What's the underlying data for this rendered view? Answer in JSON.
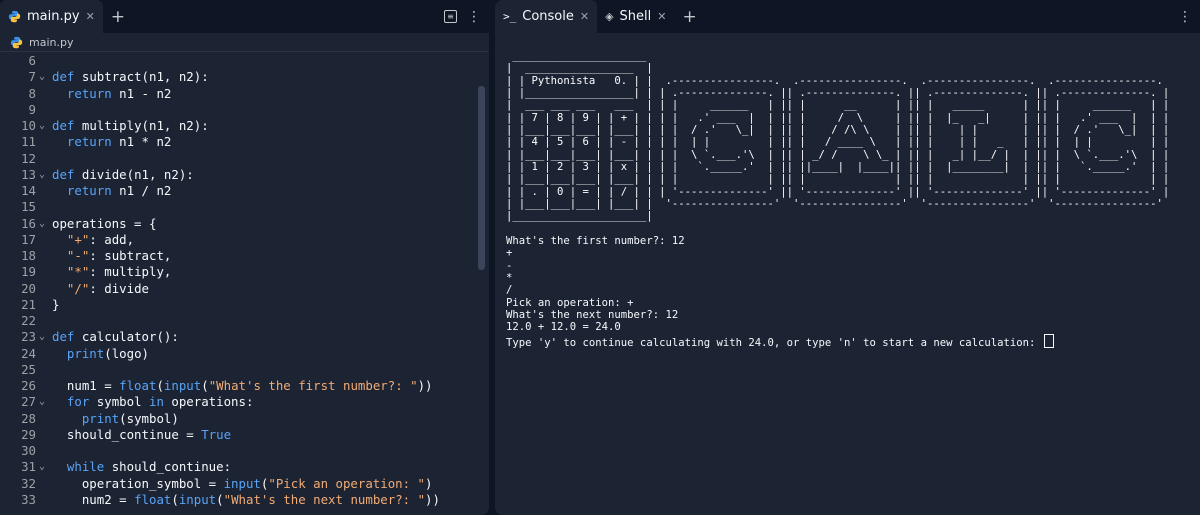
{
  "editor": {
    "tab_label": "main.py",
    "new_tab": "+",
    "breadcrumb": "main.py",
    "lines": [
      {
        "n": "6",
        "html": ""
      },
      {
        "n": "7",
        "fold": true,
        "html": "<span class=\"kw\">def</span> <span class=\"fn\">subtract</span>(n1, n2):"
      },
      {
        "n": "8",
        "html": "  <span class=\"kw\">return</span> n1 - n2"
      },
      {
        "n": "9",
        "html": ""
      },
      {
        "n": "10",
        "fold": true,
        "html": "<span class=\"kw\">def</span> <span class=\"fn\">multiply</span>(n1, n2):"
      },
      {
        "n": "11",
        "html": "  <span class=\"kw\">return</span> n1 * n2"
      },
      {
        "n": "12",
        "html": ""
      },
      {
        "n": "13",
        "fold": true,
        "html": "<span class=\"kw\">def</span> <span class=\"fn\">divide</span>(n1, n2):"
      },
      {
        "n": "14",
        "html": "  <span class=\"kw\">return</span> n1 / n2"
      },
      {
        "n": "15",
        "html": ""
      },
      {
        "n": "16",
        "fold": true,
        "html": "operations = {"
      },
      {
        "n": "17",
        "html": "  <span class=\"str\">\"+\"</span>: add,"
      },
      {
        "n": "18",
        "html": "  <span class=\"str\">\"-\"</span>: subtract,"
      },
      {
        "n": "19",
        "html": "  <span class=\"str\">\"*\"</span>: multiply,"
      },
      {
        "n": "20",
        "html": "  <span class=\"str\">\"/\"</span>: divide"
      },
      {
        "n": "21",
        "html": "}"
      },
      {
        "n": "22",
        "html": ""
      },
      {
        "n": "23",
        "fold": true,
        "html": "<span class=\"kw\">def</span> <span class=\"fn\">calculator</span>():"
      },
      {
        "n": "24",
        "html": "  <span class=\"kw\">print</span>(logo)"
      },
      {
        "n": "25",
        "html": ""
      },
      {
        "n": "26",
        "html": "  num1 = <span class=\"kw\">float</span>(<span class=\"kw\">input</span>(<span class=\"str\">\"What's the first number?: \"</span>))"
      },
      {
        "n": "27",
        "fold": true,
        "html": "  <span class=\"kw\">for</span> symbol <span class=\"kw\">in</span> operations:"
      },
      {
        "n": "28",
        "html": "    <span class=\"kw\">print</span>(symbol)"
      },
      {
        "n": "29",
        "html": "  should_continue = <span class=\"cst\">True</span>"
      },
      {
        "n": "30",
        "html": ""
      },
      {
        "n": "31",
        "fold": true,
        "html": "  <span class=\"kw\">while</span> should_continue:"
      },
      {
        "n": "32",
        "html": "    operation_symbol = <span class=\"kw\">input</span>(<span class=\"str\">\"Pick an operation: \"</span>)"
      },
      {
        "n": "33",
        "html": "    num2 = <span class=\"kw\">float</span>(<span class=\"kw\">input</span>(<span class=\"str\">\"What's the next number?: \"</span>))"
      }
    ]
  },
  "console": {
    "tab_console": "Console",
    "tab_shell": "Shell",
    "new_tab": "+",
    "logo": " _____________________\n|  _________________  |\n| | Pythonista   0. | |  .----------------.  .----------------.  .----------------.  .----------------.\n| |_________________| | | .--------------. || .--------------. || .--------------. || .--------------. |\n|  ___ ___ ___   ___  | | |     ______   | || |      __      | || |   _____      | || |     ______   | |\n| | 7 | 8 | 9 | | + | | | |   .' ___  |  | || |     /  \\     | || |  |_   _|     | || |   .' ___  |  | |\n| |___|___|___| |___| | | |  / .'   \\_|  | || |    / /\\ \\    | || |    | |       | || |  / .'   \\_|  | |\n| | 4 | 5 | 6 | | - | | | |  | |         | || |   / ____ \\   | || |    | |   _   | || |  | |         | |\n| |___|___|___| |___| | | |  \\ `.___.'\\  | || | _/ /    \\ \\_ | || |   _| |__/ |  | || |  \\ `.___.'\\  | |\n| | 1 | 2 | 3 | | x | | | |   `._____.'  | || ||____|  |____|| || |  |________|  | || |   `._____.'  | |\n| |___|___|___| |___| | | |              | || |              | || |              | || |              | |\n| | . | 0 | = | | / | | | '--------------' || '--------------' || '--------------' || '--------------' |\n| |___|___|___| |___| |  '----------------'  '----------------'  '----------------'  '----------------'\n|_____________________|",
    "output": [
      "What's the first number?: 12",
      "+",
      "-",
      "*",
      "/",
      "Pick an operation: +",
      "What's the next number?: 12",
      "12.0 + 12.0 = 24.0",
      "Type 'y' to continue calculating with 24.0, or type 'n' to start a new calculation: "
    ]
  }
}
